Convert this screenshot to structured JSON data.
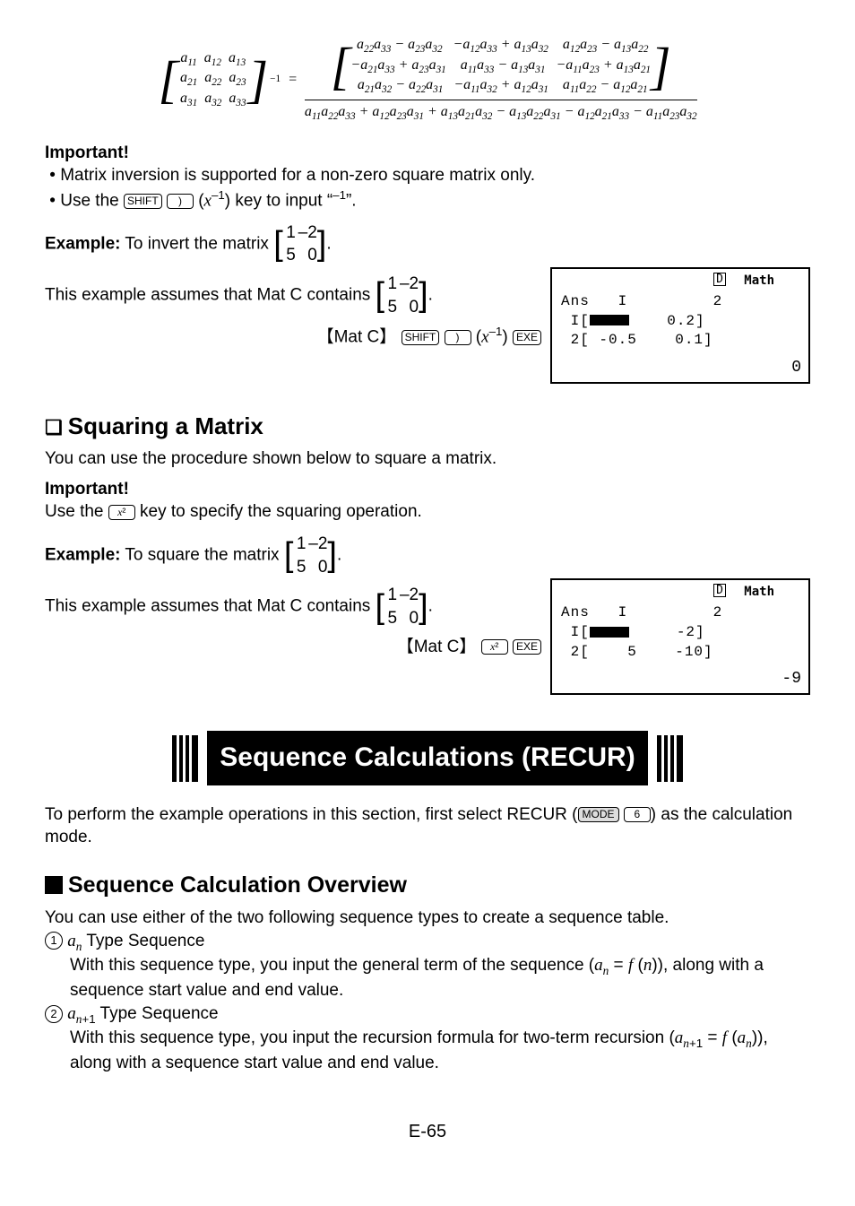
{
  "top_formula": {
    "lhs_matrix": [
      [
        "a₁₁",
        "a₁₂",
        "a₁₃"
      ],
      [
        "a₂₁",
        "a₂₂",
        "a₂₃"
      ],
      [
        "a₃₁",
        "a₃₂",
        "a₃₃"
      ]
    ],
    "lhs_exponent": "−1",
    "rhs_num_rows": [
      "a₂₂a₃₃ − a₂₃a₃₂   −a₁₂a₃₃ + a₁₃a₃₂    a₁₂a₂₃ − a₁₃a₂₂",
      "−a₂₁a₃₃ + a₂₃a₃₁    a₁₁a₃₃ − a₁₃a₃₁   −a₁₁a₂₃ + a₁₃a₂₁",
      "a₂₁a₃₂ − a₂₂a₃₁   −a₁₁a₃₂ + a₁₂a₃₁    a₁₁a₂₂ − a₁₂a₂₁"
    ],
    "rhs_den": "a₁₁a₂₂a₃₃ + a₁₂a₂₃a₃₁ + a₁₃a₂₁a₃₂ − a₁₃a₂₂a₃₁ − a₁₂a₂₁a₃₃ − a₁₁a₂₃a₃₂"
  },
  "important1": {
    "heading": "Important!",
    "bullet1": "Matrix inversion is supported for a non-zero square matrix only.",
    "bullet2_pre": "Use the ",
    "bullet2_key1": "SHIFT",
    "bullet2_key2": ")",
    "bullet2_mid": "(x⁻¹) key to input “",
    "bullet2_sup": "–1",
    "bullet2_post": "”."
  },
  "example1": {
    "label": "Example:",
    "text": " To invert the matrix ",
    "matrix": [
      [
        "1",
        "–2"
      ],
      [
        "5",
        "0"
      ]
    ],
    "period": "."
  },
  "assume1": {
    "text": "This example assumes that Mat C contains ",
    "matrix": [
      [
        "1",
        "–2"
      ],
      [
        "5",
        "0"
      ]
    ],
    "period": "."
  },
  "keyseq1": {
    "pre": "【Mat C】",
    "k1": "SHIFT",
    "k2": ")",
    "mid": "(x⁻¹)",
    "k3": "EXE"
  },
  "lcd1": {
    "d": "D",
    "math": "Math",
    "ans_label": "Ans",
    "row1": "I",
    "matrix_display": "[[0, 0.2],[-0.5, 0.1]]",
    "result": "0"
  },
  "squaring": {
    "heading": "Squaring a Matrix",
    "intro": "You can use the procedure shown below to square a matrix.",
    "important": "Important!",
    "imp_text_pre": "Use the ",
    "imp_key": "x²",
    "imp_text_post": " key to specify the squaring operation."
  },
  "example2": {
    "label": "Example:",
    "text": " To square the matrix ",
    "matrix": [
      [
        "1",
        "–2"
      ],
      [
        "5",
        "0"
      ]
    ],
    "period": "."
  },
  "assume2": {
    "text": "This example assumes that Mat C contains ",
    "matrix": [
      [
        "1",
        "–2"
      ],
      [
        "5",
        "0"
      ]
    ],
    "period": "."
  },
  "keyseq2": {
    "pre": "【Mat C】",
    "k1": "x²",
    "k2": "EXE"
  },
  "lcd2": {
    "d": "D",
    "math": "Math",
    "ans_label": "Ans",
    "matrix_display": "[[-9, -2],[5, -10]]",
    "result": "-9"
  },
  "banner": {
    "title": "Sequence Calculations (RECUR)"
  },
  "recur_intro": {
    "pre": "To perform the example operations in this section, first select RECUR (",
    "k1": "MODE",
    "k2": "6",
    "post": ") as the calculation mode."
  },
  "overview": {
    "heading": "Sequence Calculation Overview",
    "intro": "You can use either of the two following sequence types to create a sequence table.",
    "item1_num": "1",
    "item1_title": " Type Sequence",
    "item1_var": "aₙ",
    "item1_body_pre": "With this sequence type, you input the general term of the sequence (",
    "item1_formula": "aₙ = f (n)",
    "item1_body_post": "), along with a sequence start value and end value.",
    "item2_num": "2",
    "item2_var": "aₙ₊₁",
    "item2_title": " Type Sequence",
    "item2_body_pre": "With this sequence type, you input the recursion formula for two-term recursion (",
    "item2_formula1": "aₙ₊₁",
    "item2_eq": " = ",
    "item2_formula2": "f (aₙ)",
    "item2_body_post": "), along with a sequence start value and end value."
  },
  "page": "E-65"
}
